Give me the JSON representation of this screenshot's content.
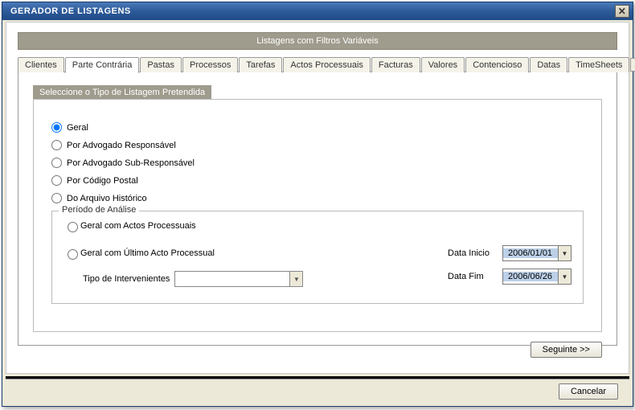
{
  "window": {
    "title": "GERADOR DE LISTAGENS"
  },
  "subtitle": "Listagens com Filtros Variáveis",
  "tabs": {
    "t0": "Clientes",
    "t1": "Parte Contrária",
    "t2": "Pastas",
    "t3": "Processos",
    "t4": "Tarefas",
    "t5": "Actos Processuais",
    "t6": "Facturas",
    "t7": "Valores",
    "t8": "Contencioso",
    "t9": "Datas",
    "t10": "TimeSheets"
  },
  "section": {
    "title": "Seleccione o Tipo de Listagem Pretendida"
  },
  "radios": {
    "r0": "Geral",
    "r1": "Por Advogado Responsável",
    "r2": "Por Advogado Sub-Responsável",
    "r3": "Por Código Postal",
    "r4": "Do Arquivo Histórico"
  },
  "period": {
    "legend": "Período de Análise",
    "r0": "Geral com Actos Processuais",
    "r1": "Geral com Último Acto Processual",
    "tipo_label": "Tipo de Intervenientes",
    "tipo_value": "",
    "data_inicio_label": "Data Inicio",
    "data_inicio_value": "2006/01/01",
    "data_fim_label": "Data Fim",
    "data_fim_value": "2006/06/26"
  },
  "buttons": {
    "next": "Seguinte >>",
    "cancel": "Cancelar"
  }
}
